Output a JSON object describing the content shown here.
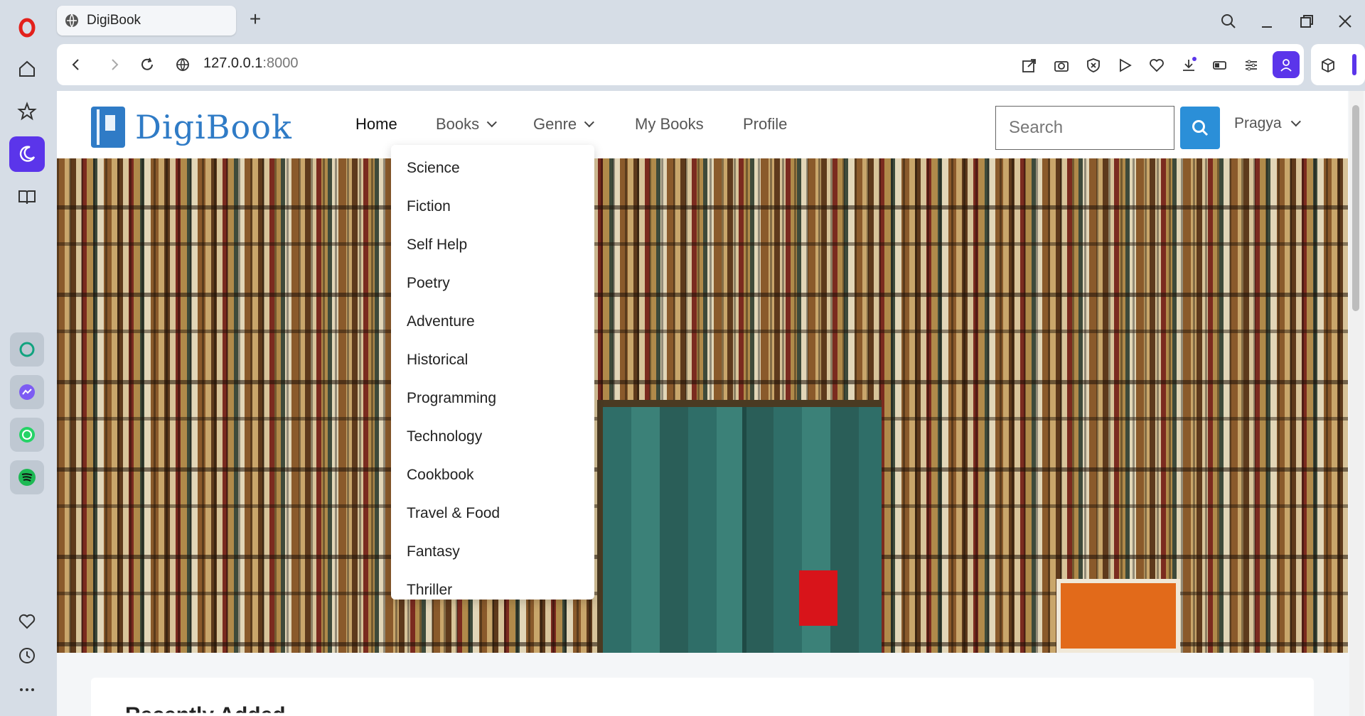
{
  "browser": {
    "tab_title": "DigiBook",
    "new_tab": "+",
    "url_host": "127.0.0.1",
    "url_port": ":8000"
  },
  "site": {
    "logo_text": "DigiBook",
    "menu": {
      "home": "Home",
      "books": "Books",
      "genre": "Genre",
      "my_books": "My Books",
      "profile": "Profile"
    },
    "search_placeholder": "Search",
    "user_name": "Pragya"
  },
  "genre_dropdown": [
    "Science",
    "Fiction",
    "Self Help",
    "Poetry",
    "Adventure",
    "Historical",
    "Programming",
    "Technology",
    "Cookbook",
    "Travel & Food",
    "Fantasy",
    "Thriller"
  ],
  "section": {
    "recently_added": "Recently Added"
  },
  "colors": {
    "accent": "#2b8fd8",
    "opera_purple": "#5b35ea",
    "opera_red": "#e3201b"
  }
}
